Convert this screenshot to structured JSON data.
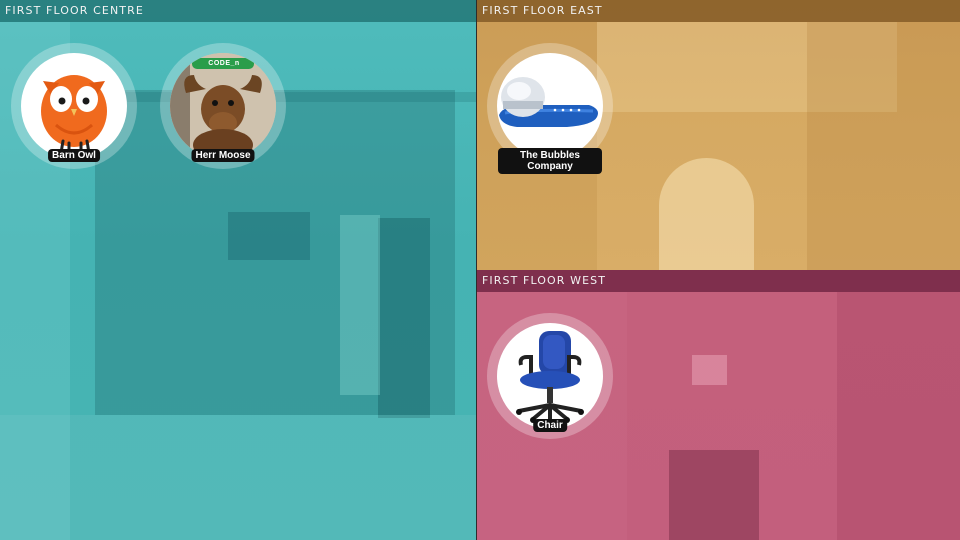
{
  "zones": {
    "centre": {
      "title": "FIRST FLOOR CENTRE"
    },
    "east": {
      "title": "FIRST FLOOR EAST"
    },
    "west": {
      "title": "FIRST FLOOR WEST"
    }
  },
  "devices": {
    "barn_owl": {
      "label": "Barn Owl",
      "icon": "owl-plush-icon"
    },
    "herr_moose": {
      "label": "Herr Moose",
      "icon": "moose-plush-icon",
      "badge_text": "CODE_n"
    },
    "bubbles": {
      "label": "The Bubbles Company",
      "icon": "bubble-machine-icon"
    },
    "chair": {
      "label": "Chair",
      "icon": "office-chair-icon"
    }
  },
  "colors": {
    "centre": "#4fbcbc",
    "east": "#d6aa63",
    "west": "#c4607c"
  }
}
